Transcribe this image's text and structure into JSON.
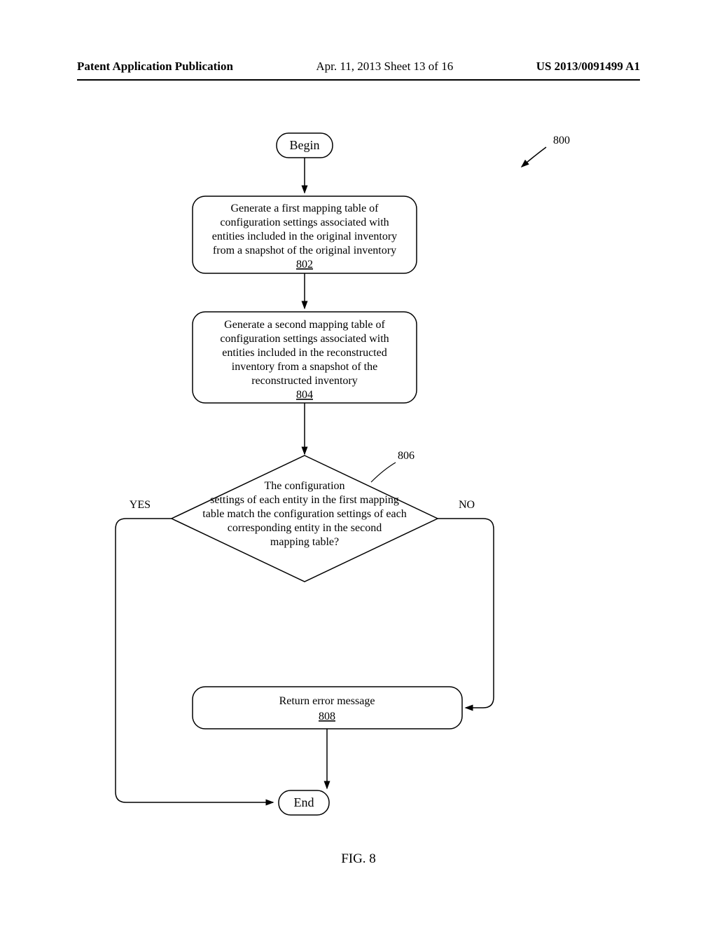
{
  "header": {
    "left": "Patent Application Publication",
    "center": "Apr. 11, 2013  Sheet 13 of 16",
    "right": "US 2013/0091499 A1"
  },
  "flowchart": {
    "begin": "Begin",
    "end": "End",
    "ref_label": "800",
    "step802": {
      "line1": "Generate a first mapping table of",
      "line2": "configuration settings associated with",
      "line3": "entities included in the original inventory",
      "line4": "from a snapshot of the original inventory",
      "ref": "802"
    },
    "step804": {
      "line1": "Generate a second mapping table of",
      "line2": "configuration settings associated with",
      "line3": "entities included in the reconstructed",
      "line4": "inventory from a snapshot of the",
      "line5": "reconstructed inventory",
      "ref": "804"
    },
    "decision806": {
      "line1": "The configuration",
      "line2": "settings of each entity in the first mapping",
      "line3": "table match the configuration settings of each",
      "line4": "corresponding entity in the second",
      "line5": "mapping table?",
      "ref": "806"
    },
    "step808": {
      "line1": "Return error message",
      "ref": "808"
    },
    "yes": "YES",
    "no": "NO"
  },
  "caption": "FIG. 8"
}
